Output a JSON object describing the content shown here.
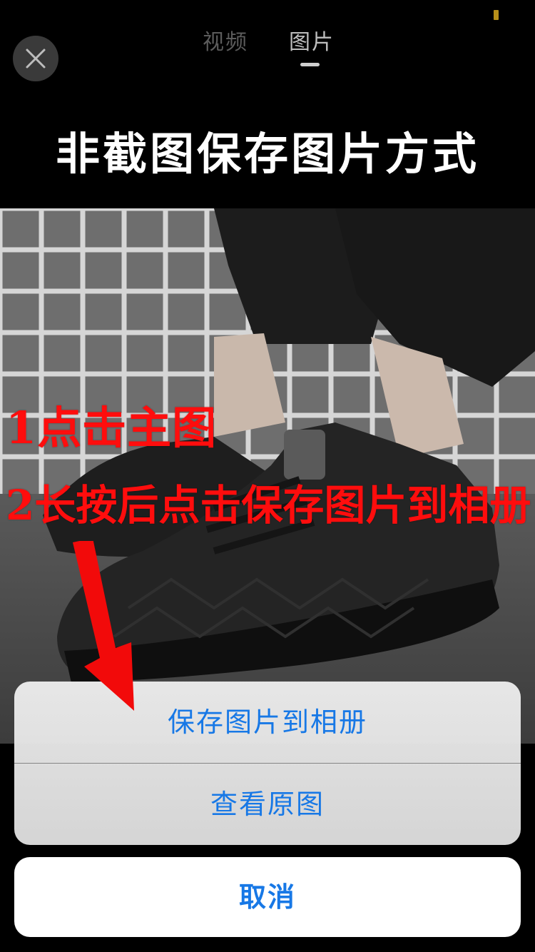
{
  "tabs": {
    "video": "视频",
    "photo": "图片",
    "active": "photo"
  },
  "headline": "非截图保存图片方式",
  "instructions": {
    "step1": "1点击主图",
    "step2": "2长按后点击保存图片到相册"
  },
  "action_sheet": {
    "save_to_album": "保存图片到相册",
    "view_original": "查看原图",
    "cancel": "取消"
  },
  "icons": {
    "close": "close-icon",
    "arrow": "arrow-down-icon"
  },
  "colors": {
    "action_text": "#1778e6",
    "annotation_red": "#ff0d0d",
    "background": "#000000"
  }
}
